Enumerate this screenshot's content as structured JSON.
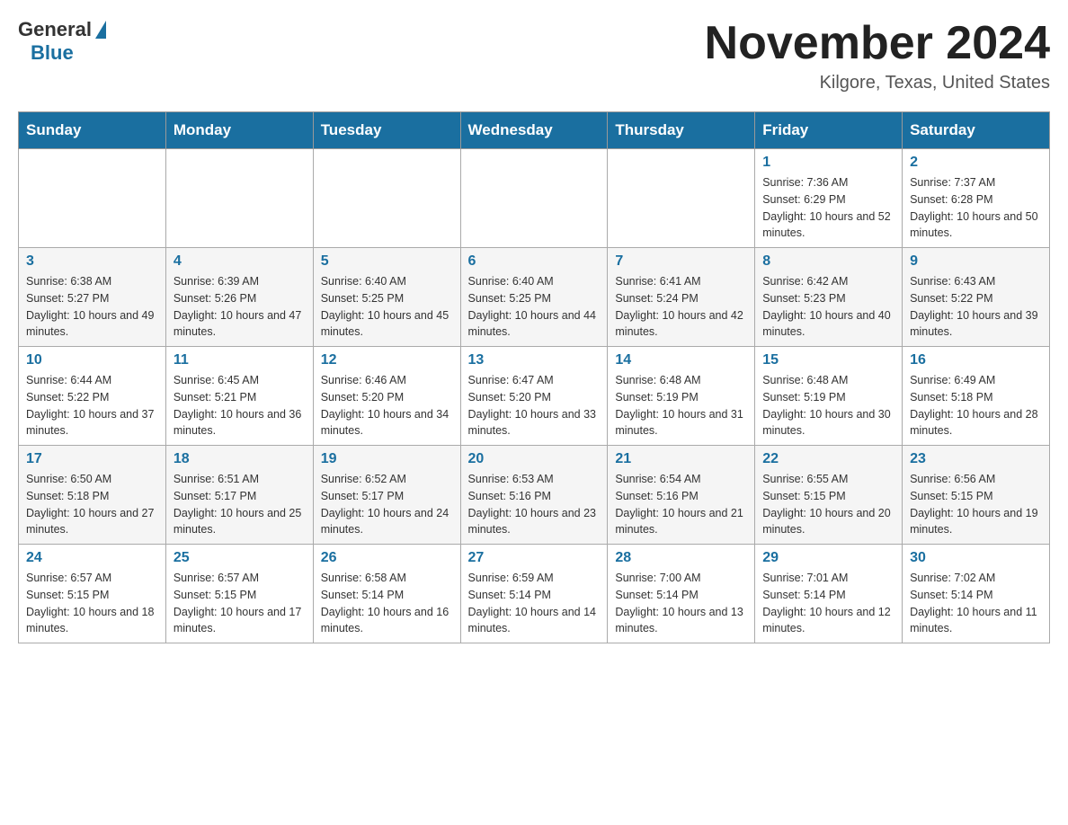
{
  "header": {
    "logo": {
      "general_text": "General",
      "blue_text": "Blue"
    },
    "title": "November 2024",
    "location": "Kilgore, Texas, United States"
  },
  "days_of_week": [
    "Sunday",
    "Monday",
    "Tuesday",
    "Wednesday",
    "Thursday",
    "Friday",
    "Saturday"
  ],
  "weeks": [
    {
      "days": [
        {
          "number": "",
          "info": ""
        },
        {
          "number": "",
          "info": ""
        },
        {
          "number": "",
          "info": ""
        },
        {
          "number": "",
          "info": ""
        },
        {
          "number": "",
          "info": ""
        },
        {
          "number": "1",
          "info": "Sunrise: 7:36 AM\nSunset: 6:29 PM\nDaylight: 10 hours and 52 minutes."
        },
        {
          "number": "2",
          "info": "Sunrise: 7:37 AM\nSunset: 6:28 PM\nDaylight: 10 hours and 50 minutes."
        }
      ]
    },
    {
      "days": [
        {
          "number": "3",
          "info": "Sunrise: 6:38 AM\nSunset: 5:27 PM\nDaylight: 10 hours and 49 minutes."
        },
        {
          "number": "4",
          "info": "Sunrise: 6:39 AM\nSunset: 5:26 PM\nDaylight: 10 hours and 47 minutes."
        },
        {
          "number": "5",
          "info": "Sunrise: 6:40 AM\nSunset: 5:25 PM\nDaylight: 10 hours and 45 minutes."
        },
        {
          "number": "6",
          "info": "Sunrise: 6:40 AM\nSunset: 5:25 PM\nDaylight: 10 hours and 44 minutes."
        },
        {
          "number": "7",
          "info": "Sunrise: 6:41 AM\nSunset: 5:24 PM\nDaylight: 10 hours and 42 minutes."
        },
        {
          "number": "8",
          "info": "Sunrise: 6:42 AM\nSunset: 5:23 PM\nDaylight: 10 hours and 40 minutes."
        },
        {
          "number": "9",
          "info": "Sunrise: 6:43 AM\nSunset: 5:22 PM\nDaylight: 10 hours and 39 minutes."
        }
      ]
    },
    {
      "days": [
        {
          "number": "10",
          "info": "Sunrise: 6:44 AM\nSunset: 5:22 PM\nDaylight: 10 hours and 37 minutes."
        },
        {
          "number": "11",
          "info": "Sunrise: 6:45 AM\nSunset: 5:21 PM\nDaylight: 10 hours and 36 minutes."
        },
        {
          "number": "12",
          "info": "Sunrise: 6:46 AM\nSunset: 5:20 PM\nDaylight: 10 hours and 34 minutes."
        },
        {
          "number": "13",
          "info": "Sunrise: 6:47 AM\nSunset: 5:20 PM\nDaylight: 10 hours and 33 minutes."
        },
        {
          "number": "14",
          "info": "Sunrise: 6:48 AM\nSunset: 5:19 PM\nDaylight: 10 hours and 31 minutes."
        },
        {
          "number": "15",
          "info": "Sunrise: 6:48 AM\nSunset: 5:19 PM\nDaylight: 10 hours and 30 minutes."
        },
        {
          "number": "16",
          "info": "Sunrise: 6:49 AM\nSunset: 5:18 PM\nDaylight: 10 hours and 28 minutes."
        }
      ]
    },
    {
      "days": [
        {
          "number": "17",
          "info": "Sunrise: 6:50 AM\nSunset: 5:18 PM\nDaylight: 10 hours and 27 minutes."
        },
        {
          "number": "18",
          "info": "Sunrise: 6:51 AM\nSunset: 5:17 PM\nDaylight: 10 hours and 25 minutes."
        },
        {
          "number": "19",
          "info": "Sunrise: 6:52 AM\nSunset: 5:17 PM\nDaylight: 10 hours and 24 minutes."
        },
        {
          "number": "20",
          "info": "Sunrise: 6:53 AM\nSunset: 5:16 PM\nDaylight: 10 hours and 23 minutes."
        },
        {
          "number": "21",
          "info": "Sunrise: 6:54 AM\nSunset: 5:16 PM\nDaylight: 10 hours and 21 minutes."
        },
        {
          "number": "22",
          "info": "Sunrise: 6:55 AM\nSunset: 5:15 PM\nDaylight: 10 hours and 20 minutes."
        },
        {
          "number": "23",
          "info": "Sunrise: 6:56 AM\nSunset: 5:15 PM\nDaylight: 10 hours and 19 minutes."
        }
      ]
    },
    {
      "days": [
        {
          "number": "24",
          "info": "Sunrise: 6:57 AM\nSunset: 5:15 PM\nDaylight: 10 hours and 18 minutes."
        },
        {
          "number": "25",
          "info": "Sunrise: 6:57 AM\nSunset: 5:15 PM\nDaylight: 10 hours and 17 minutes."
        },
        {
          "number": "26",
          "info": "Sunrise: 6:58 AM\nSunset: 5:14 PM\nDaylight: 10 hours and 16 minutes."
        },
        {
          "number": "27",
          "info": "Sunrise: 6:59 AM\nSunset: 5:14 PM\nDaylight: 10 hours and 14 minutes."
        },
        {
          "number": "28",
          "info": "Sunrise: 7:00 AM\nSunset: 5:14 PM\nDaylight: 10 hours and 13 minutes."
        },
        {
          "number": "29",
          "info": "Sunrise: 7:01 AM\nSunset: 5:14 PM\nDaylight: 10 hours and 12 minutes."
        },
        {
          "number": "30",
          "info": "Sunrise: 7:02 AM\nSunset: 5:14 PM\nDaylight: 10 hours and 11 minutes."
        }
      ]
    }
  ]
}
